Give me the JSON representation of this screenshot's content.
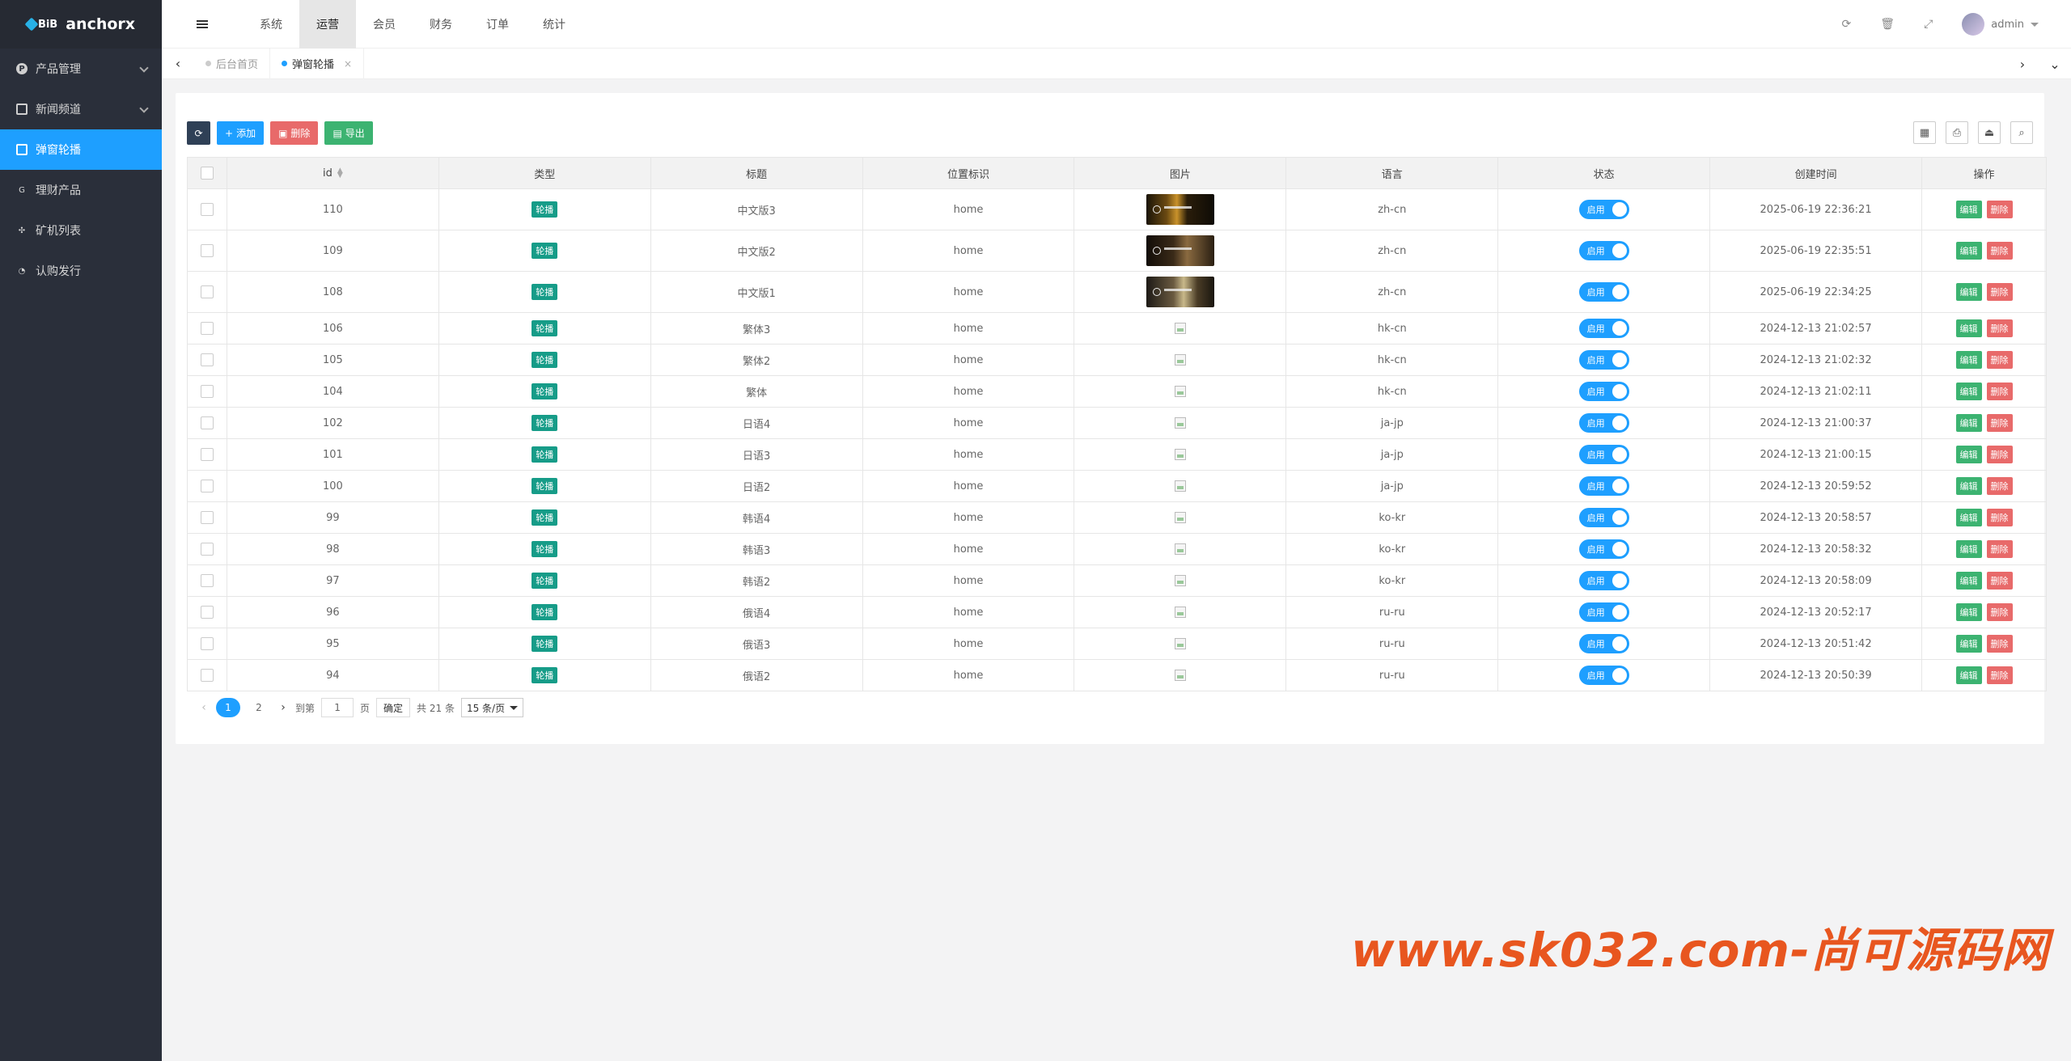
{
  "app": {
    "logo_mark": "BiB",
    "name": "anchorx"
  },
  "sidebar": {
    "items": [
      {
        "label": "产品管理",
        "icon": "product-icon",
        "expandable": true,
        "active": false
      },
      {
        "label": "新闻频道",
        "icon": "news-icon",
        "expandable": true,
        "active": false
      },
      {
        "label": "弹窗轮播",
        "icon": "carousel-icon",
        "expandable": false,
        "active": true
      },
      {
        "label": "理财产品",
        "icon": "finance-icon",
        "expandable": false,
        "active": false
      },
      {
        "label": "矿机列表",
        "icon": "miner-icon",
        "expandable": false,
        "active": false
      },
      {
        "label": "认购发行",
        "icon": "pie-icon",
        "expandable": false,
        "active": false
      }
    ]
  },
  "topnav": {
    "items": [
      "系统",
      "运营",
      "会员",
      "财务",
      "订单",
      "统计"
    ],
    "active": "运营",
    "user": "admin"
  },
  "tabs": [
    {
      "label": "后台首页",
      "active": false
    },
    {
      "label": "弹窗轮播",
      "active": true
    }
  ],
  "toolbar": {
    "add_label": "添加",
    "delete_label": "删除",
    "export_label": "导出"
  },
  "table": {
    "columns": [
      "id",
      "类型",
      "标题",
      "位置标识",
      "图片",
      "语言",
      "状态",
      "创建时间",
      "操作"
    ],
    "type_badge": "轮播",
    "switch_label": "启用",
    "edit_label": "编辑",
    "delete_label": "删除",
    "rows": [
      {
        "id": "110",
        "title": "中文版3",
        "position": "home",
        "image": "thumb-1",
        "lang": "zh-cn",
        "created": "2025-06-19 22:36:21"
      },
      {
        "id": "109",
        "title": "中文版2",
        "position": "home",
        "image": "thumb-2",
        "lang": "zh-cn",
        "created": "2025-06-19 22:35:51"
      },
      {
        "id": "108",
        "title": "中文版1",
        "position": "home",
        "image": "thumb-3",
        "lang": "zh-cn",
        "created": "2025-06-19 22:34:25"
      },
      {
        "id": "106",
        "title": "繁体3",
        "position": "home",
        "image": "broken",
        "lang": "hk-cn",
        "created": "2024-12-13 21:02:57"
      },
      {
        "id": "105",
        "title": "繁体2",
        "position": "home",
        "image": "broken",
        "lang": "hk-cn",
        "created": "2024-12-13 21:02:32"
      },
      {
        "id": "104",
        "title": "繁体",
        "position": "home",
        "image": "broken",
        "lang": "hk-cn",
        "created": "2024-12-13 21:02:11"
      },
      {
        "id": "102",
        "title": "日语4",
        "position": "home",
        "image": "broken",
        "lang": "ja-jp",
        "created": "2024-12-13 21:00:37"
      },
      {
        "id": "101",
        "title": "日语3",
        "position": "home",
        "image": "broken",
        "lang": "ja-jp",
        "created": "2024-12-13 21:00:15"
      },
      {
        "id": "100",
        "title": "日语2",
        "position": "home",
        "image": "broken",
        "lang": "ja-jp",
        "created": "2024-12-13 20:59:52"
      },
      {
        "id": "99",
        "title": "韩语4",
        "position": "home",
        "image": "broken",
        "lang": "ko-kr",
        "created": "2024-12-13 20:58:57"
      },
      {
        "id": "98",
        "title": "韩语3",
        "position": "home",
        "image": "broken",
        "lang": "ko-kr",
        "created": "2024-12-13 20:58:32"
      },
      {
        "id": "97",
        "title": "韩语2",
        "position": "home",
        "image": "broken",
        "lang": "ko-kr",
        "created": "2024-12-13 20:58:09"
      },
      {
        "id": "96",
        "title": "俄语4",
        "position": "home",
        "image": "broken",
        "lang": "ru-ru",
        "created": "2024-12-13 20:52:17"
      },
      {
        "id": "95",
        "title": "俄语3",
        "position": "home",
        "image": "broken",
        "lang": "ru-ru",
        "created": "2024-12-13 20:51:42"
      },
      {
        "id": "94",
        "title": "俄语2",
        "position": "home",
        "image": "broken",
        "lang": "ru-ru",
        "created": "2024-12-13 20:50:39"
      }
    ]
  },
  "pagination": {
    "pages": [
      "1",
      "2"
    ],
    "current": "1",
    "goto_prefix": "到第",
    "goto_value": "1",
    "goto_suffix": "页",
    "confirm_label": "确定",
    "total_label": "共 21 条",
    "page_size": "15 条/页"
  },
  "watermark": "www.sk032.com-尚可源码网",
  "colors": {
    "sidebar_bg": "#2a2f3a",
    "accent": "#1e9fff",
    "badge": "#169c88",
    "edit": "#3cb371",
    "delete": "#e86a6a",
    "watermark": "#e8561f"
  }
}
